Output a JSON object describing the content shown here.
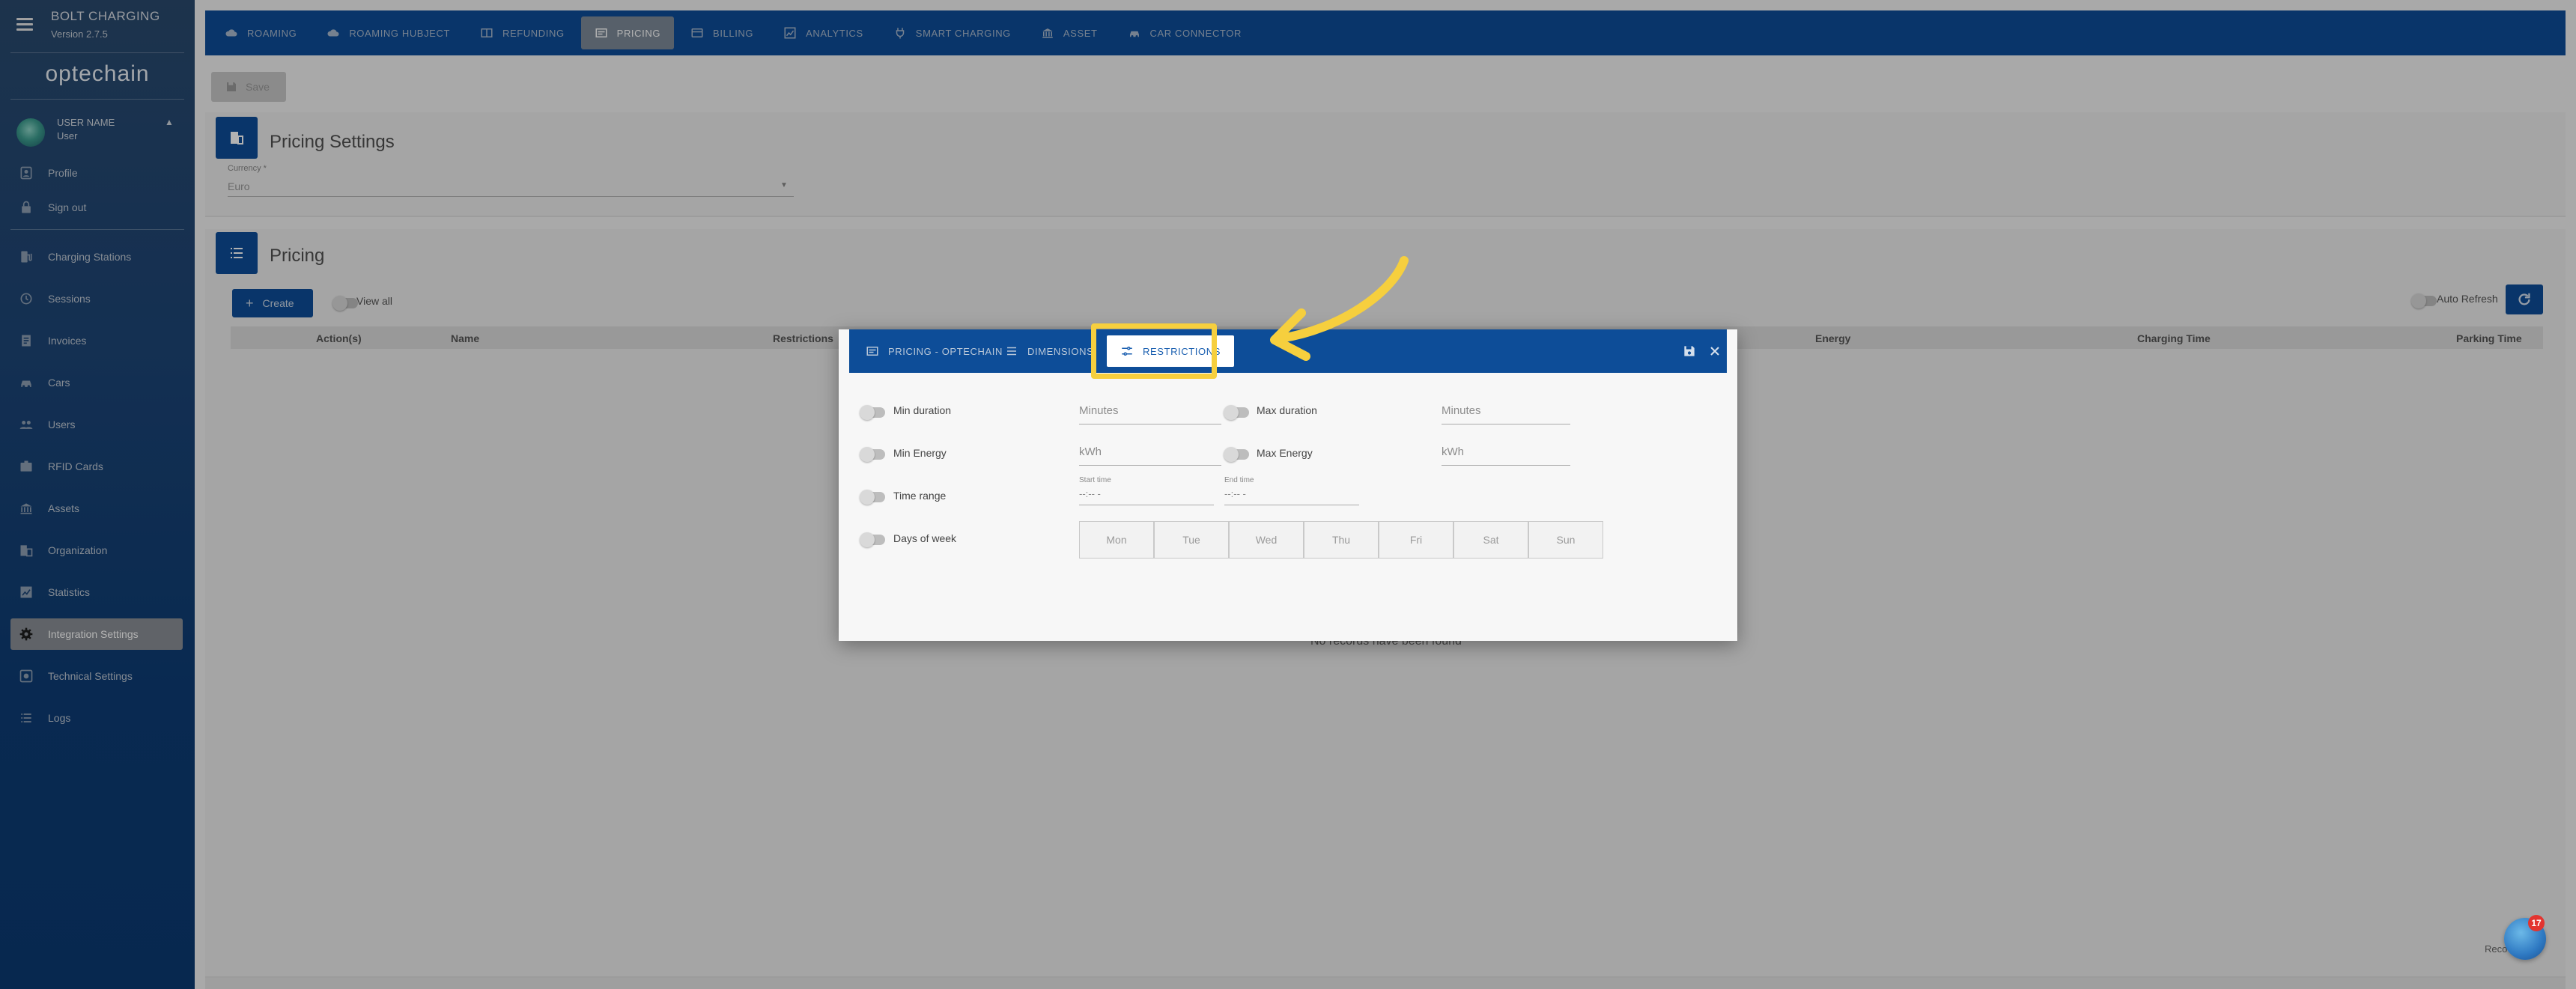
{
  "sidebar": {
    "app_title": "BOLT CHARGING",
    "app_version": "Version 2.7.5",
    "brand": "optechain",
    "user": {
      "name": "USER NAME",
      "role": "User"
    },
    "account_items": [
      {
        "label": "Profile",
        "icon": "person-icon"
      },
      {
        "label": "Sign out",
        "icon": "lock-icon"
      }
    ],
    "nav_items": [
      {
        "label": "Charging Stations",
        "icon": "charging-station-icon"
      },
      {
        "label": "Sessions",
        "icon": "history-icon"
      },
      {
        "label": "Invoices",
        "icon": "invoice-icon"
      },
      {
        "label": "Cars",
        "icon": "car-icon"
      },
      {
        "label": "Users",
        "icon": "people-icon"
      },
      {
        "label": "RFID Cards",
        "icon": "badge-icon"
      },
      {
        "label": "Assets",
        "icon": "bank-icon"
      },
      {
        "label": "Organization",
        "icon": "building-icon"
      },
      {
        "label": "Statistics",
        "icon": "chart-icon"
      },
      {
        "label": "Integration Settings",
        "icon": "gear-icon",
        "active": true
      },
      {
        "label": "Technical Settings",
        "icon": "settings-box-icon"
      },
      {
        "label": "Logs",
        "icon": "list-icon"
      }
    ]
  },
  "topbar": {
    "tabs": [
      {
        "label": "ROAMING",
        "icon": "cloud-icon"
      },
      {
        "label": "ROAMING HUBJECT",
        "icon": "cloud-icon"
      },
      {
        "label": "REFUNDING",
        "icon": "book-icon"
      },
      {
        "label": "PRICING",
        "icon": "card-icon",
        "active": true
      },
      {
        "label": "BILLING",
        "icon": "credit-card-icon"
      },
      {
        "label": "ANALYTICS",
        "icon": "analytics-icon"
      },
      {
        "label": "SMART CHARGING",
        "icon": "plug-icon"
      },
      {
        "label": "ASSET",
        "icon": "bank-icon"
      },
      {
        "label": "CAR CONNECTOR",
        "icon": "car-icon"
      }
    ]
  },
  "main": {
    "save_label": "Save",
    "pricing_settings": {
      "title": "Pricing Settings",
      "currency_label": "Currency *",
      "currency_value": "Euro"
    },
    "pricing": {
      "title": "Pricing",
      "create_label": "Create",
      "view_all_label": "View all",
      "auto_refresh_label": "Auto Refresh",
      "columns": [
        "Action(s)",
        "Name",
        "Restrictions",
        "Energy",
        "Charging Time",
        "Parking Time"
      ],
      "no_records": "No records have been found",
      "records_label": "Reco"
    }
  },
  "modal": {
    "tabs": [
      {
        "label": "PRICING - OPTECHAIN",
        "icon": "card-icon"
      },
      {
        "label": "DIMENSIONS",
        "icon": "list-icon"
      },
      {
        "label": "RESTRICTIONS",
        "icon": "tune-icon",
        "active": true
      }
    ],
    "restrictions": {
      "min_duration_label": "Min duration",
      "min_duration_placeholder": "Minutes",
      "max_duration_label": "Max duration",
      "max_duration_placeholder": "Minutes",
      "min_energy_label": "Min Energy",
      "min_energy_placeholder": "kWh",
      "max_energy_label": "Max Energy",
      "max_energy_placeholder": "kWh",
      "time_range_label": "Time range",
      "start_time_label": "Start time",
      "start_time_value": "--:-- -",
      "end_time_label": "End time",
      "end_time_value": "--:-- -",
      "days_of_week_label": "Days of week",
      "days": [
        "Mon",
        "Tue",
        "Wed",
        "Thu",
        "Fri",
        "Sat",
        "Sun"
      ]
    }
  },
  "help": {
    "badge_count": "17"
  },
  "colors": {
    "primary": "#0d4d98",
    "highlight": "#f6cf3e",
    "active_tab_text": "#1a5fb0"
  }
}
